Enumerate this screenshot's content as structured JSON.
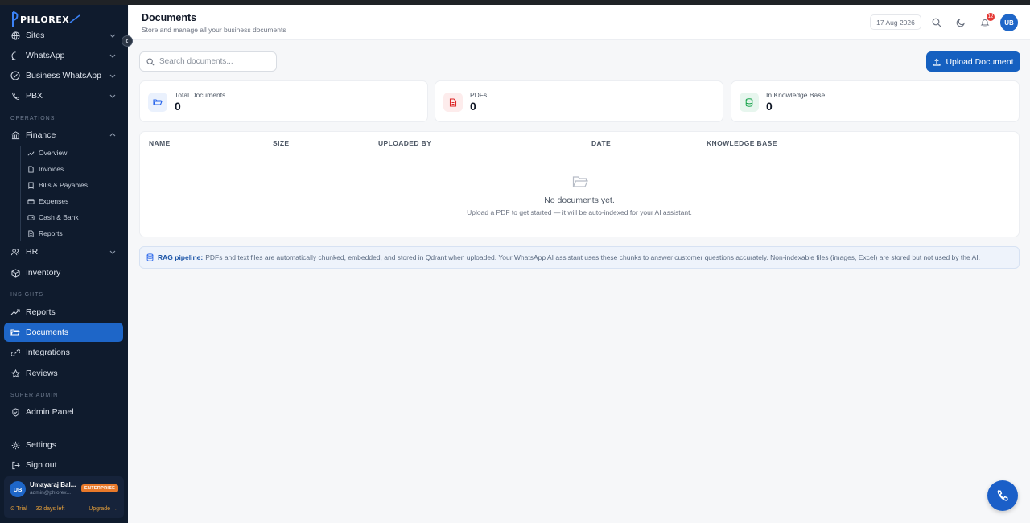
{
  "brand": {
    "logo_text": "PHLOREX"
  },
  "colors": {
    "accent": "#1e66c8",
    "sidebar_bg": "#0f1b2d",
    "enterprise": "#e8792a",
    "notif": "#e53935"
  },
  "sidebar": {
    "items_top": [
      {
        "label": "Sites",
        "icon": "globe-icon"
      },
      {
        "label": "WhatsApp",
        "icon": "chat-bubble-icon"
      },
      {
        "label": "Business WhatsApp",
        "icon": "check-circle-icon"
      },
      {
        "label": "PBX",
        "icon": "phone-icon"
      }
    ],
    "sections": {
      "operations": "OPERATIONS",
      "insights": "INSIGHTS",
      "super_admin": "SUPER ADMIN"
    },
    "finance": {
      "label": "Finance",
      "sub_items": [
        {
          "label": "Overview",
          "icon": "trend-icon"
        },
        {
          "label": "Invoices",
          "icon": "file-icon"
        },
        {
          "label": "Bills & Payables",
          "icon": "receipt-icon"
        },
        {
          "label": "Expenses",
          "icon": "card-icon"
        },
        {
          "label": "Cash & Bank",
          "icon": "wallet-icon"
        },
        {
          "label": "Reports",
          "icon": "doc-icon"
        }
      ]
    },
    "hr": "HR",
    "inventory": "Inventory",
    "reports": "Reports",
    "documents": "Documents",
    "integrations": "Integrations",
    "reviews": "Reviews",
    "admin_panel": "Admin Panel",
    "settings": "Settings",
    "sign_out": "Sign out",
    "user": {
      "initials": "UB",
      "name": "Umayaraj Bal...",
      "email": "admin@phlorex...",
      "plan_badge": "ENTERPRISE",
      "trial": "⏲ Trial — 32 days left",
      "upgrade": "Upgrade →"
    }
  },
  "header": {
    "title": "Documents",
    "subtitle": "Store and manage all your business documents",
    "date": "17 Aug 2026",
    "notifications": "12",
    "avatar": "UB"
  },
  "main": {
    "search_placeholder": "Search documents...",
    "upload_label": "Upload Document",
    "stats": [
      {
        "label": "Total Documents",
        "value": "0",
        "icon": "folder-open-icon"
      },
      {
        "label": "PDFs",
        "value": "0",
        "icon": "pdf-file-icon"
      },
      {
        "label": "In Knowledge Base",
        "value": "0",
        "icon": "database-icon"
      }
    ],
    "table": {
      "columns": [
        "NAME",
        "SIZE",
        "UPLOADED BY",
        "DATE",
        "KNOWLEDGE BASE"
      ],
      "empty_title": "No documents yet.",
      "empty_sub": "Upload a PDF to get started — it will be auto-indexed for your AI assistant."
    },
    "rag": {
      "label": "RAG pipeline:",
      "text": "PDFs and text files are automatically chunked, embedded, and stored in Qdrant when uploaded. Your WhatsApp AI assistant uses these chunks to answer customer questions accurately. Non-indexable files (images, Excel) are stored but not used by the AI."
    }
  }
}
